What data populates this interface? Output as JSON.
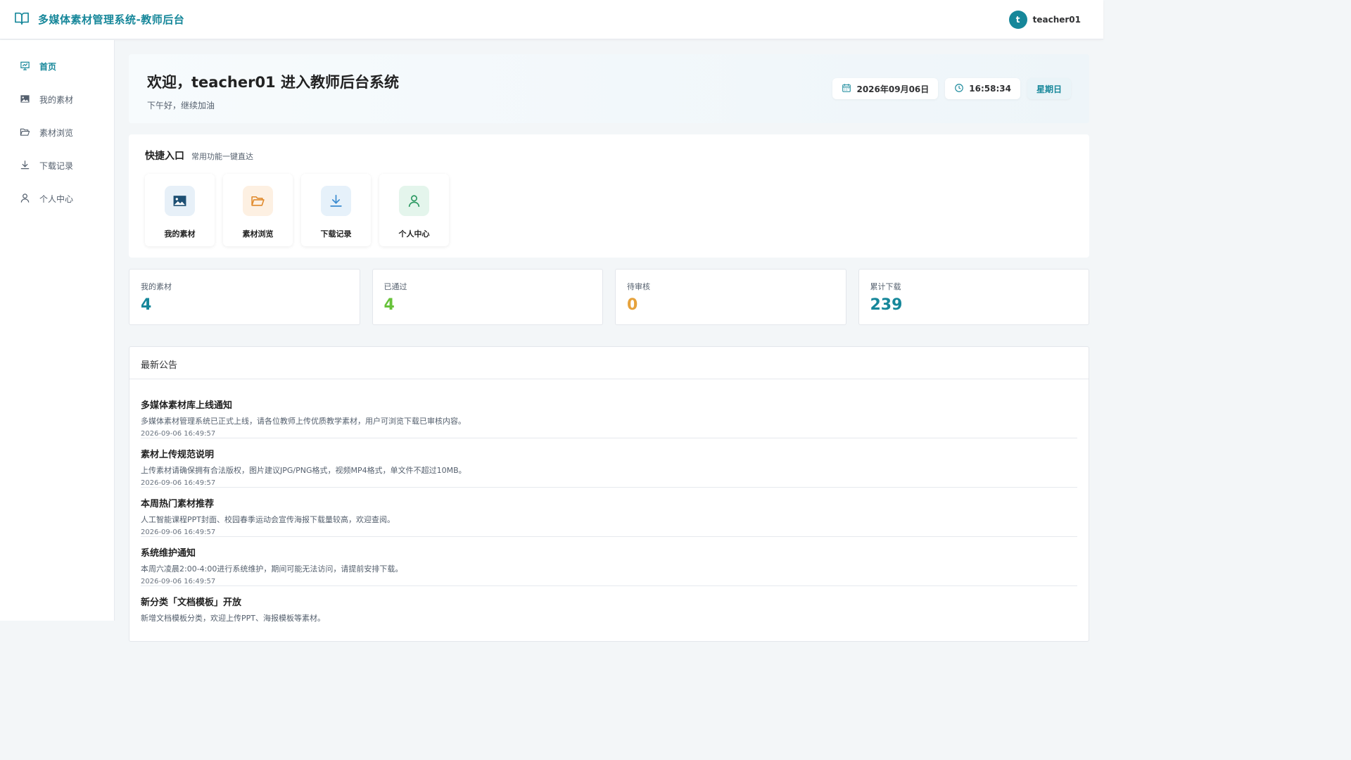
{
  "header": {
    "title": "多媒体素材管理系统-教师后台",
    "avatar_letter": "t",
    "username": "teacher01"
  },
  "sidebar": {
    "items": [
      {
        "label": "首页",
        "icon": "presentation-icon",
        "active": true
      },
      {
        "label": "我的素材",
        "icon": "image-icon",
        "active": false
      },
      {
        "label": "素材浏览",
        "icon": "folder-open-icon",
        "active": false
      },
      {
        "label": "下载记录",
        "icon": "download-icon",
        "active": false
      },
      {
        "label": "个人中心",
        "icon": "user-icon",
        "active": false
      }
    ]
  },
  "welcome": {
    "title": "欢迎，teacher01 进入教师后台系统",
    "subtitle": "下午好，继续加油",
    "date": "2026年09月06日",
    "time": "16:58:34",
    "weekday": "星期日"
  },
  "quick": {
    "title": "快捷入口",
    "subtitle": "常用功能一键直达",
    "tiles": [
      {
        "label": "我的素材",
        "icon": "image-icon",
        "color": "#1d4f73",
        "bg": "#e7f0f8"
      },
      {
        "label": "素材浏览",
        "icon": "folder-open-icon",
        "color": "#e08a2c",
        "bg": "#fdf0e2"
      },
      {
        "label": "下载记录",
        "icon": "download-icon",
        "color": "#3a8bd0",
        "bg": "#e6f1fa"
      },
      {
        "label": "个人中心",
        "icon": "user-icon",
        "color": "#2e9a63",
        "bg": "#e4f5ec"
      }
    ]
  },
  "stats": [
    {
      "label": "我的素材",
      "value": "4",
      "color": "#16879a"
    },
    {
      "label": "已通过",
      "value": "4",
      "color": "#67c23a"
    },
    {
      "label": "待审核",
      "value": "0",
      "color": "#e6a23c"
    },
    {
      "label": "累计下载",
      "value": "239",
      "color": "#16879a"
    }
  ],
  "notices": {
    "title": "最新公告",
    "items": [
      {
        "title": "多媒体素材库上线通知",
        "body": "多媒体素材管理系统已正式上线，请各位教师上传优质教学素材，用户可浏览下载已审核内容。",
        "date": "2026-09-06 16:49:57"
      },
      {
        "title": "素材上传规范说明",
        "body": "上传素材请确保拥有合法版权，图片建议JPG/PNG格式，视频MP4格式，单文件不超过10MB。",
        "date": "2026-09-06 16:49:57"
      },
      {
        "title": "本周热门素材推荐",
        "body": "人工智能课程PPT封面、校园春季运动会宣传海报下载量较高，欢迎查阅。",
        "date": "2026-09-06 16:49:57"
      },
      {
        "title": "系统维护通知",
        "body": "本周六凌晨2:00-4:00进行系统维护，期间可能无法访问，请提前安排下载。",
        "date": "2026-09-06 16:49:57"
      },
      {
        "title": "新分类「文档模板」开放",
        "body": "新增文档模板分类，欢迎上传PPT、海报模板等素材。",
        "date": ""
      }
    ]
  },
  "colors": {
    "accent": "#16879a"
  }
}
